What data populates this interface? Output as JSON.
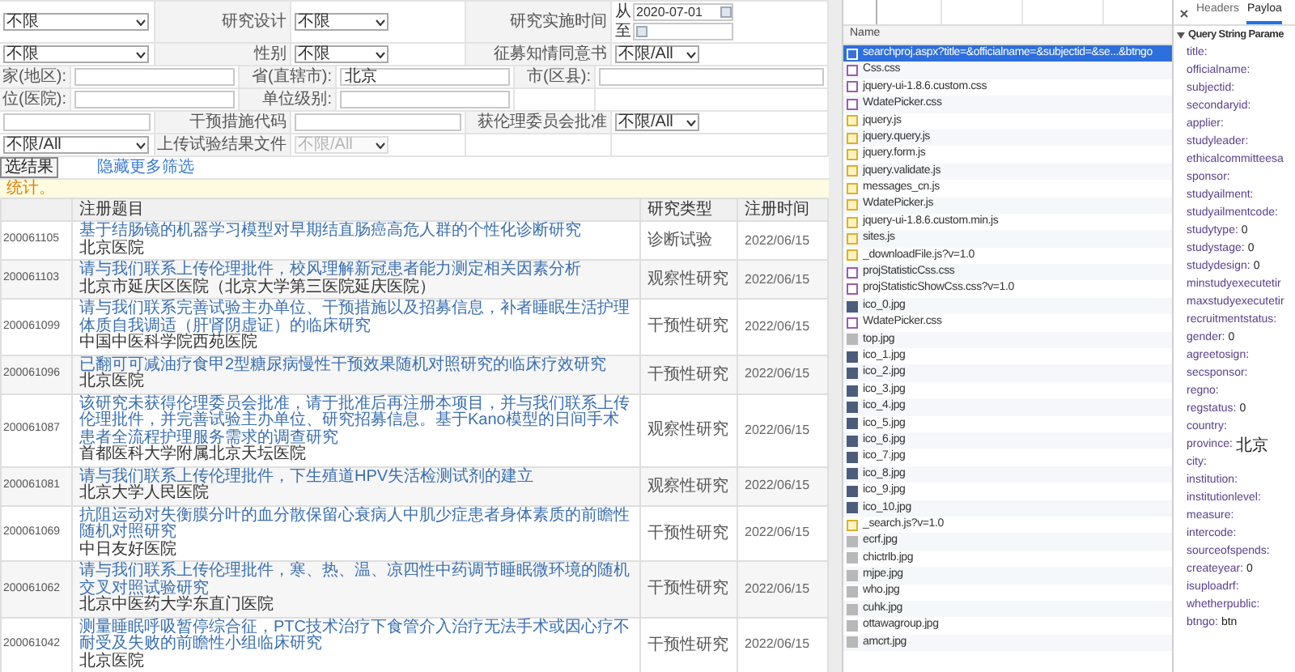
{
  "filters": {
    "criteria_top": [
      {
        "cells": [
          {
            "kind": "select",
            "text": "不限",
            "disabled": false
          },
          {
            "kind": "label",
            "text": "研究设计"
          },
          {
            "kind": "select",
            "text": "不限",
            "disabled": false
          },
          {
            "kind": "label",
            "text": "研究实施时间"
          },
          {
            "kind": "date_range",
            "from_label": "从",
            "from": "2020-07-01",
            "to_label": "至"
          }
        ]
      },
      {
        "cells": [
          {
            "kind": "select",
            "text": "不限",
            "disabled": false
          },
          {
            "kind": "label",
            "text": "性别"
          },
          {
            "kind": "select",
            "text": "不限",
            "disabled": false
          },
          {
            "kind": "label",
            "text": "征募知情同意书"
          },
          {
            "kind": "select",
            "text": "不限/All",
            "disabled": false
          }
        ]
      }
    ],
    "location": [
      {
        "cells": [
          {
            "kind": "label",
            "text": "家(地区):"
          },
          {
            "kind": "input"
          },
          {
            "kind": "label",
            "text": "省(直辖市):"
          },
          {
            "kind": "input",
            "value": "北京"
          },
          {
            "kind": "label",
            "text": "市(区县):"
          },
          {
            "kind": "input"
          }
        ]
      },
      {
        "cells": [
          {
            "kind": "label",
            "text": "位(医院):"
          },
          {
            "kind": "input"
          },
          {
            "kind": "label",
            "text": "单位级别:"
          },
          {
            "kind": "input"
          },
          {
            "kind": "blank"
          },
          {
            "kind": "blank"
          }
        ]
      }
    ],
    "criteria_bottom": [
      {
        "cells": [
          {
            "kind": "input"
          },
          {
            "kind": "label",
            "text": "干预措施代码"
          },
          {
            "kind": "input"
          },
          {
            "kind": "label",
            "text": "获伦理委员会批准"
          },
          {
            "kind": "select",
            "text": "不限/All",
            "disabled": false
          }
        ]
      },
      {
        "cells": [
          {
            "kind": "select",
            "text": "不限/All",
            "disabled": false
          },
          {
            "kind": "label",
            "text": "上传试验结果文件"
          },
          {
            "kind": "select",
            "text": "不限/All",
            "disabled": true
          },
          {
            "kind": "blank"
          },
          {
            "kind": "blank"
          }
        ]
      }
    ],
    "actions": [
      {
        "kind": "button",
        "text": "选结果"
      },
      {
        "kind": "link",
        "text": "隐藏更多筛选"
      }
    ]
  },
  "notice": "统计。",
  "table": {
    "columns": [
      "注册题目",
      "研究类型",
      "注册时间"
    ],
    "rows": [
      {
        "id": "200061105",
        "title": "基于结肠镜的机器学习模型对早期结直肠癌高危人群的个性化诊断研究",
        "institution": "北京医院",
        "type": "诊断试验",
        "date": "2022/06/15"
      },
      {
        "id": "200061103",
        "title": "请与我们联系上传伦理批件，校风理解新冠患者能力测定相关因素分析",
        "institution": "北京市延庆区医院（北京大学第三医院延庆医院）",
        "type": "观察性研究",
        "date": "2022/06/15"
      },
      {
        "id": "200061099",
        "title": "请与我们联系完善试验主办单位、干预措施以及招募信息，补者睡眠生活护理体质自我调适（肝肾阴虚证）的临床研究",
        "institution": "中国中医科学院西苑医院",
        "type": "干预性研究",
        "date": "2022/06/15"
      },
      {
        "id": "200061096",
        "title": "已翻可可减油疗食甲2型糖尿病慢性干预效果随机对照研究的临床疗效研究",
        "institution": "北京医院",
        "type": "干预性研究",
        "date": "2022/06/15"
      },
      {
        "id": "200061087",
        "title": "该研究未获得伦理委员会批准，请于批准后再注册本项目，并与我们联系上传伦理批件，并完善试验主办单位、研究招募信息。基于Kano模型的日间手术患者全流程护理服务需求的调查研究",
        "institution": "首都医科大学附属北京天坛医院",
        "type": "观察性研究",
        "date": "2022/06/15"
      },
      {
        "id": "200061081",
        "title": "请与我们联系上传伦理批件，下生殖道HPV失活检测试剂的建立",
        "institution": "北京大学人民医院",
        "type": "观察性研究",
        "date": "2022/06/15"
      },
      {
        "id": "200061069",
        "title": "抗阻运动对失衡膜分叶的血分散保留心衰病人中肌少症患者身体素质的前瞻性随机对照研究",
        "institution": "中日友好医院",
        "type": "干预性研究",
        "date": "2022/06/15"
      },
      {
        "id": "200061062",
        "title": "请与我们联系上传伦理批件，寒、热、温、凉四性中药调节睡眠微环境的随机交叉对照试验研究",
        "institution": "北京中医药大学东直门医院",
        "type": "干预性研究",
        "date": "2022/06/15"
      },
      {
        "id": "200061042",
        "title": "测量睡眠呼吸暂停综合征，PTC技术治疗下食管介入治疗无法手术或因心疗不耐受及失败的前瞻性小组临床研究",
        "institution": "北京医院",
        "type": "干预性研究",
        "date": "2022/06/15"
      }
    ]
  },
  "network": {
    "name_header": "Name",
    "requests": [
      {
        "name": "searchproj.aspx?title=&officialname=&subjectid=&se...&btngo",
        "kind": "document",
        "selected": true
      },
      {
        "name": "Css.css",
        "kind": "stylesheet",
        "selected": false
      },
      {
        "name": "jquery-ui-1.8.6.custom.css",
        "kind": "stylesheet",
        "selected": false
      },
      {
        "name": "WdatePicker.css",
        "kind": "stylesheet",
        "selected": false
      },
      {
        "name": "jquery.js",
        "kind": "script",
        "selected": false
      },
      {
        "name": "jquery.query.js",
        "kind": "script",
        "selected": false
      },
      {
        "name": "jquery.form.js",
        "kind": "script",
        "selected": false
      },
      {
        "name": "jquery.validate.js",
        "kind": "script",
        "selected": false
      },
      {
        "name": "messages_cn.js",
        "kind": "script",
        "selected": false
      },
      {
        "name": "WdatePicker.js",
        "kind": "script",
        "selected": false
      },
      {
        "name": "jquery-ui-1.8.6.custom.min.js",
        "kind": "script",
        "selected": false
      },
      {
        "name": "sites.js",
        "kind": "script",
        "selected": false
      },
      {
        "name": "_downloadFile.js?v=1.0",
        "kind": "script",
        "selected": false
      },
      {
        "name": "projStatisticCss.css",
        "kind": "stylesheet",
        "selected": false
      },
      {
        "name": "projStatisticShowCss.css?v=1.0",
        "kind": "stylesheet",
        "selected": false
      },
      {
        "name": "ico_0.jpg",
        "kind": "image",
        "selected": false
      },
      {
        "name": "WdatePicker.css",
        "kind": "stylesheet",
        "selected": false
      },
      {
        "name": "top.jpg",
        "kind": "thumbnail",
        "selected": false
      },
      {
        "name": "ico_1.jpg",
        "kind": "image",
        "selected": false
      },
      {
        "name": "ico_2.jpg",
        "kind": "image",
        "selected": false
      },
      {
        "name": "ico_3.jpg",
        "kind": "image",
        "selected": false
      },
      {
        "name": "ico_4.jpg",
        "kind": "image",
        "selected": false
      },
      {
        "name": "ico_5.jpg",
        "kind": "image",
        "selected": false
      },
      {
        "name": "ico_6.jpg",
        "kind": "image",
        "selected": false
      },
      {
        "name": "ico_7.jpg",
        "kind": "image",
        "selected": false
      },
      {
        "name": "ico_8.jpg",
        "kind": "image",
        "selected": false
      },
      {
        "name": "ico_9.jpg",
        "kind": "image",
        "selected": false
      },
      {
        "name": "ico_10.jpg",
        "kind": "image",
        "selected": false
      },
      {
        "name": "_search.js?v=1.0",
        "kind": "script",
        "selected": false
      },
      {
        "name": "ecrf.jpg",
        "kind": "thumbnail",
        "selected": false
      },
      {
        "name": "chictrlb.jpg",
        "kind": "thumbnail",
        "selected": false
      },
      {
        "name": "mjpe.jpg",
        "kind": "thumbnail",
        "selected": false
      },
      {
        "name": "who.jpg",
        "kind": "thumbnail",
        "selected": false
      },
      {
        "name": "cuhk.jpg",
        "kind": "thumbnail",
        "selected": false
      },
      {
        "name": "ottawagroup.jpg",
        "kind": "thumbnail",
        "selected": false
      },
      {
        "name": "amcrt.jpg",
        "kind": "thumbnail",
        "selected": false
      }
    ]
  },
  "details": {
    "tabs": [
      {
        "label": "Headers",
        "selected": false
      },
      {
        "label": "Payloa",
        "selected": true
      }
    ],
    "section": "Query String Parame",
    "params": [
      {
        "key": "title:"
      },
      {
        "key": "officialname:"
      },
      {
        "key": "subjectid:"
      },
      {
        "key": "secondaryid:"
      },
      {
        "key": "applier:"
      },
      {
        "key": "studyleader:"
      },
      {
        "key": "ethicalcommitteesa"
      },
      {
        "key": "sponsor:"
      },
      {
        "key": "studyailment:"
      },
      {
        "key": "studyailmentcode:"
      },
      {
        "key": "studytype:",
        "value": "0"
      },
      {
        "key": "studystage:",
        "value": "0"
      },
      {
        "key": "studydesign:",
        "value": "0"
      },
      {
        "key": "minstudyexecutetir"
      },
      {
        "key": "maxstudyexecutetir"
      },
      {
        "key": "recruitmentstatus:"
      },
      {
        "key": "gender:",
        "value": "0"
      },
      {
        "key": "agreetosign:"
      },
      {
        "key": "secsponsor:"
      },
      {
        "key": "regno:"
      },
      {
        "key": "regstatus:",
        "value": "0"
      },
      {
        "key": "country:"
      },
      {
        "key": "province:",
        "value": "北京"
      },
      {
        "key": "city:"
      },
      {
        "key": "institution:"
      },
      {
        "key": "institutionlevel:"
      },
      {
        "key": "measure:"
      },
      {
        "key": "intercode:"
      },
      {
        "key": "sourceofspends:"
      },
      {
        "key": "createyear:",
        "value": "0"
      },
      {
        "key": "isuploadrf:"
      },
      {
        "key": "whetherpublic:"
      },
      {
        "key": "btngo:",
        "value": "btn"
      }
    ]
  }
}
